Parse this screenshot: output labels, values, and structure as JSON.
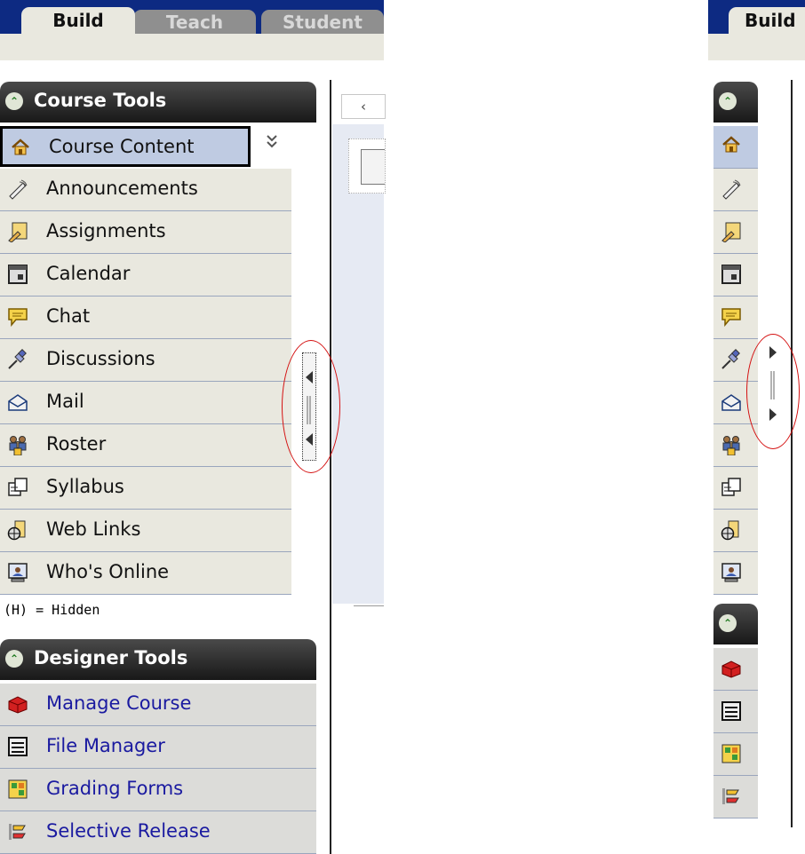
{
  "tabs": [
    {
      "label": "Build",
      "active": true
    },
    {
      "label": "Teach",
      "active": false
    },
    {
      "label": "Student",
      "active": false
    }
  ],
  "right_tab": {
    "label": "Build"
  },
  "course_tools": {
    "title": "Course Tools",
    "dropdown_icon": "double-chevron-down-icon",
    "items": [
      {
        "label": "Course Content",
        "icon": "home-icon",
        "selected": true
      },
      {
        "label": "Announcements",
        "icon": "megaphone-icon"
      },
      {
        "label": "Assignments",
        "icon": "assignment-icon"
      },
      {
        "label": "Calendar",
        "icon": "calendar-icon"
      },
      {
        "label": "Chat",
        "icon": "chat-icon"
      },
      {
        "label": "Discussions",
        "icon": "pushpin-icon"
      },
      {
        "label": "Mail",
        "icon": "mail-icon"
      },
      {
        "label": "Roster",
        "icon": "people-icon"
      },
      {
        "label": "Syllabus",
        "icon": "syllabus-icon"
      },
      {
        "label": "Web Links",
        "icon": "globe-icon"
      },
      {
        "label": "Who's Online",
        "icon": "online-icon"
      }
    ],
    "note": "(H) = Hidden"
  },
  "designer_tools": {
    "title": "Designer Tools",
    "items": [
      {
        "label": "Manage Course",
        "icon": "toolbox-icon"
      },
      {
        "label": "File Manager",
        "icon": "file-manager-icon"
      },
      {
        "label": "Grading Forms",
        "icon": "grading-forms-icon"
      },
      {
        "label": "Selective Release",
        "icon": "selective-release-icon"
      }
    ]
  },
  "main_nav_left": "‹",
  "colors": {
    "tabbar": "#0d2a82",
    "selected_row": "#bfcbe2",
    "highlight_oval": "#d41010",
    "link_blue": "#1a1aa0"
  }
}
